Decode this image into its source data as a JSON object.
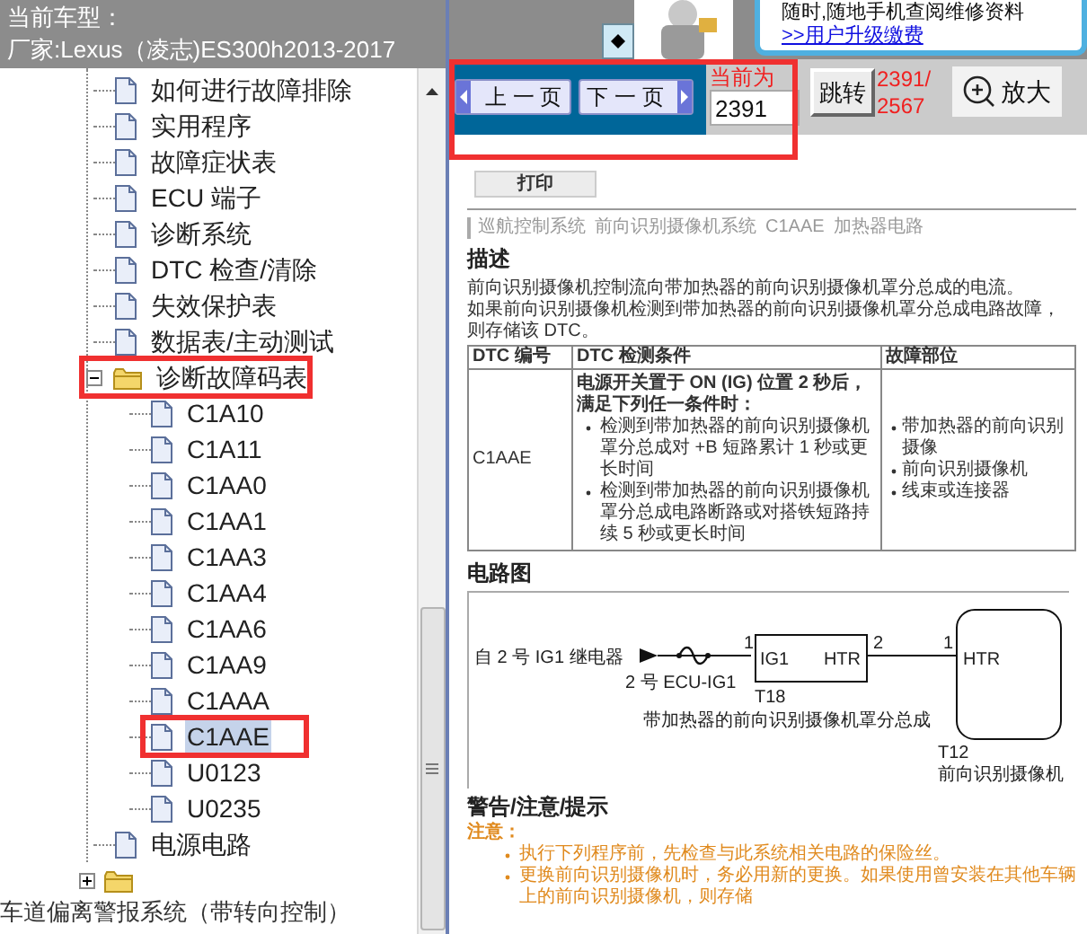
{
  "header": {
    "label": "当前车型：",
    "vehicle": "厂家:Lexus（凌志)ES300h2013-2017"
  },
  "tree": {
    "items": [
      {
        "kind": "page",
        "label": "如何进行故障排除",
        "selected": false,
        "annotated": false
      },
      {
        "kind": "page",
        "label": "实用程序",
        "selected": false,
        "annotated": false
      },
      {
        "kind": "page",
        "label": "故障症状表",
        "selected": false,
        "annotated": false
      },
      {
        "kind": "page",
        "label": "ECU 端子",
        "selected": false,
        "annotated": false
      },
      {
        "kind": "page",
        "label": "诊断系统",
        "selected": false,
        "annotated": false
      },
      {
        "kind": "page",
        "label": "DTC 检查/清除",
        "selected": false,
        "annotated": false
      },
      {
        "kind": "page",
        "label": "失效保护表",
        "selected": false,
        "annotated": false
      },
      {
        "kind": "page",
        "label": "数据表/主动测试",
        "selected": false,
        "annotated": false
      },
      {
        "kind": "folder",
        "label": "诊断故障码表",
        "selected": false,
        "annotated": true,
        "expanded": true,
        "children": [
          {
            "kind": "page",
            "label": "C1A10",
            "selected": false,
            "annotated": false
          },
          {
            "kind": "page",
            "label": "C1A11",
            "selected": false,
            "annotated": false
          },
          {
            "kind": "page",
            "label": "C1AA0",
            "selected": false,
            "annotated": false
          },
          {
            "kind": "page",
            "label": "C1AA1",
            "selected": false,
            "annotated": false
          },
          {
            "kind": "page",
            "label": "C1AA3",
            "selected": false,
            "annotated": false
          },
          {
            "kind": "page",
            "label": "C1AA4",
            "selected": false,
            "annotated": false
          },
          {
            "kind": "page",
            "label": "C1AA6",
            "selected": false,
            "annotated": false
          },
          {
            "kind": "page",
            "label": "C1AA9",
            "selected": false,
            "annotated": false
          },
          {
            "kind": "page",
            "label": "C1AAA",
            "selected": false,
            "annotated": false
          },
          {
            "kind": "page",
            "label": "C1AAE",
            "selected": true,
            "annotated": true
          },
          {
            "kind": "page",
            "label": "U0123",
            "selected": false,
            "annotated": false
          },
          {
            "kind": "page",
            "label": "U0235",
            "selected": false,
            "annotated": false
          }
        ]
      },
      {
        "kind": "page",
        "label": "电源电路",
        "selected": false,
        "annotated": false
      }
    ],
    "outer_folder": {
      "expanded": false
    },
    "next_section": "车道偏离警报系统（带转向控制）"
  },
  "ad": {
    "tagline": "随时,随地手机查阅维修资料",
    "link": ">>用户升级缴费"
  },
  "toolbar": {
    "prev": "上 一 页",
    "next": "下 一 页",
    "current_label": "当前为",
    "current_page": "2391",
    "go": "跳转",
    "page_count": "2391/2567",
    "zoom": "放大",
    "annotated": true
  },
  "document": {
    "print": "打印",
    "breadcrumb": [
      "巡航控制系统",
      "前向识别摄像机系统",
      "C1AAE",
      "加热器电路"
    ],
    "description_heading": "描述",
    "description": [
      "前向识别摄像机控制流向带加热器的前向识别摄像机罩分总成的电流。",
      "如果前向识别摄像机检测到带加热器的前向识别摄像机罩分总成电路故障，则存储该 DTC。"
    ],
    "dtc_table": {
      "columns": [
        "DTC 编号",
        "DTC 检测条件",
        "故障部位"
      ],
      "rows": [
        {
          "code": "C1AAE",
          "condition": "电源开关置于 ON (IG) 位置 2 秒后，满足下列任一条件时：",
          "condition_items": [
            "检测到带加热器的前向识别摄像机罩分总成对 +B 短路累计 1 秒或更长时间",
            "检测到带加热器的前向识别摄像机罩分总成电路断路或对搭铁短路持续 5 秒或更长时间"
          ],
          "areas": [
            "带加热器的前向识别摄像",
            "前向识别摄像机",
            "线束或连接器"
          ]
        }
      ]
    },
    "circuit_heading": "电路图",
    "circuit": {
      "source": "自 2 号 IG1 继电器",
      "fuse": "2 号 ECU-IG1",
      "t18": {
        "pin_in": "1",
        "pin_in_label": "IG1",
        "pin_out": "2",
        "pin_out_label": "HTR",
        "connector": "T18",
        "name": "带加热器的前向识别摄像机罩分总成"
      },
      "t12": {
        "pin": "1",
        "pin_label": "HTR",
        "connector": "T12",
        "name": "前向识别摄像机"
      }
    },
    "warnings_heading": "警告/注意/提示",
    "notice_label": "注意：",
    "notice_items": [
      "执行下列程序前，先检查与此系统相关电路的保险丝。",
      "更换前向识别摄像机时，务必用新的更换。如果使用曾安装在其他车辆上的前向识别摄像机，则存储"
    ]
  }
}
